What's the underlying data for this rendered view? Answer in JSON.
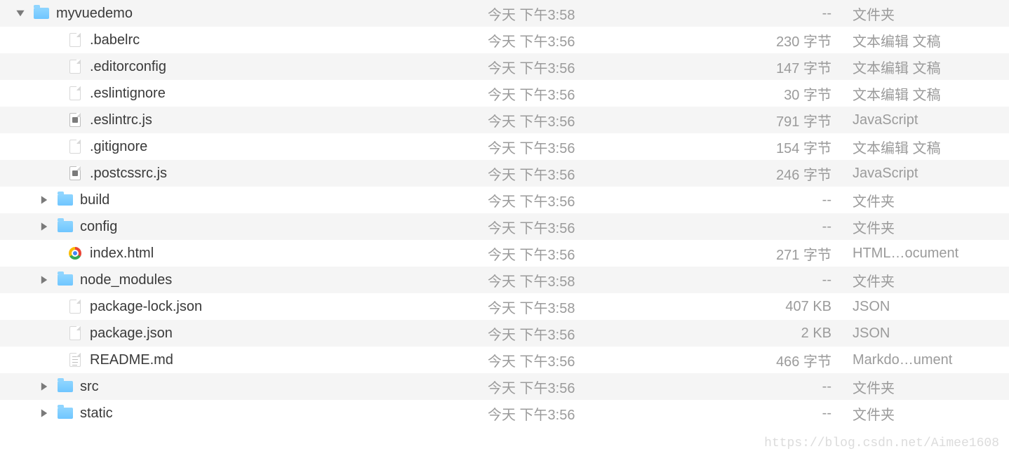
{
  "watermark": "https://blog.csdn.net/Aimee1608",
  "rows": [
    {
      "indent": 0,
      "arrow": "down",
      "icon": "folder",
      "name": "myvuedemo",
      "date": "今天 下午3:58",
      "size": "--",
      "kind": "文件夹",
      "alt": true
    },
    {
      "indent": 2,
      "arrow": "",
      "icon": "file",
      "name": ".babelrc",
      "date": "今天 下午3:56",
      "size": "230 字节",
      "kind": "文本编辑 文稿",
      "alt": false
    },
    {
      "indent": 2,
      "arrow": "",
      "icon": "file",
      "name": ".editorconfig",
      "date": "今天 下午3:56",
      "size": "147 字节",
      "kind": "文本编辑 文稿",
      "alt": true
    },
    {
      "indent": 2,
      "arrow": "",
      "icon": "file",
      "name": ".eslintignore",
      "date": "今天 下午3:56",
      "size": "30 字节",
      "kind": "文本编辑 文稿",
      "alt": false
    },
    {
      "indent": 2,
      "arrow": "",
      "icon": "js",
      "name": ".eslintrc.js",
      "date": "今天 下午3:56",
      "size": "791 字节",
      "kind": "JavaScript",
      "alt": true
    },
    {
      "indent": 2,
      "arrow": "",
      "icon": "file",
      "name": ".gitignore",
      "date": "今天 下午3:56",
      "size": "154 字节",
      "kind": "文本编辑 文稿",
      "alt": false
    },
    {
      "indent": 2,
      "arrow": "",
      "icon": "js",
      "name": ".postcssrc.js",
      "date": "今天 下午3:56",
      "size": "246 字节",
      "kind": "JavaScript",
      "alt": true
    },
    {
      "indent": 1,
      "arrow": "right",
      "icon": "folder",
      "name": "build",
      "date": "今天 下午3:56",
      "size": "--",
      "kind": "文件夹",
      "alt": false
    },
    {
      "indent": 1,
      "arrow": "right",
      "icon": "folder",
      "name": "config",
      "date": "今天 下午3:56",
      "size": "--",
      "kind": "文件夹",
      "alt": true
    },
    {
      "indent": 2,
      "arrow": "",
      "icon": "chrome",
      "name": "index.html",
      "date": "今天 下午3:56",
      "size": "271 字节",
      "kind": "HTML…ocument",
      "alt": false
    },
    {
      "indent": 1,
      "arrow": "right",
      "icon": "folder",
      "name": "node_modules",
      "date": "今天 下午3:58",
      "size": "--",
      "kind": "文件夹",
      "alt": true
    },
    {
      "indent": 2,
      "arrow": "",
      "icon": "file",
      "name": "package-lock.json",
      "date": "今天 下午3:58",
      "size": "407 KB",
      "kind": "JSON",
      "alt": false
    },
    {
      "indent": 2,
      "arrow": "",
      "icon": "file",
      "name": "package.json",
      "date": "今天 下午3:56",
      "size": "2 KB",
      "kind": "JSON",
      "alt": true
    },
    {
      "indent": 2,
      "arrow": "",
      "icon": "md",
      "name": "README.md",
      "date": "今天 下午3:56",
      "size": "466 字节",
      "kind": "Markdo…ument",
      "alt": false
    },
    {
      "indent": 1,
      "arrow": "right",
      "icon": "folder",
      "name": "src",
      "date": "今天 下午3:56",
      "size": "--",
      "kind": "文件夹",
      "alt": true
    },
    {
      "indent": 1,
      "arrow": "right",
      "icon": "folder",
      "name": "static",
      "date": "今天 下午3:56",
      "size": "--",
      "kind": "文件夹",
      "alt": false
    }
  ]
}
